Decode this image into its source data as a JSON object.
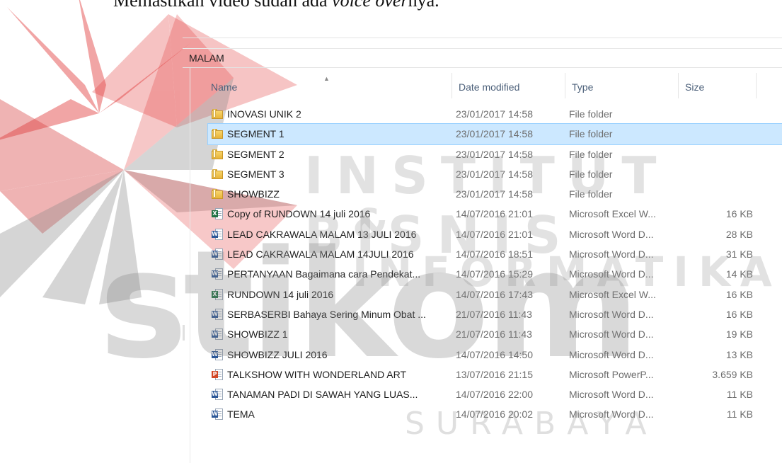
{
  "caption": {
    "prefix": "Memastikan video sudah ada ",
    "italic": "voice over",
    "suffix": "nya."
  },
  "watermark": {
    "line1": "INSTITUT BISNIS",
    "line2": "& INFORMATIKA",
    "brand": "stikom",
    "city": "SURABAYA"
  },
  "explorer": {
    "path": "MALAM",
    "columns": {
      "name": "Name",
      "date": "Date modified",
      "type": "Type",
      "size": "Size"
    },
    "files": [
      {
        "name": "INOVASI UNIK 2",
        "date": "23/01/2017 14:58",
        "type": "File folder",
        "size": "",
        "icon": "folder-icon"
      },
      {
        "name": "SEGMENT 1",
        "date": "23/01/2017 14:58",
        "type": "File folder",
        "size": "",
        "icon": "folder-icon",
        "selected": true
      },
      {
        "name": "SEGMENT 2",
        "date": "23/01/2017 14:58",
        "type": "File folder",
        "size": "",
        "icon": "folder-icon"
      },
      {
        "name": "SEGMENT 3",
        "date": "23/01/2017 14:58",
        "type": "File folder",
        "size": "",
        "icon": "folder-icon"
      },
      {
        "name": "SHOWBIZZ",
        "date": "23/01/2017 14:58",
        "type": "File folder",
        "size": "",
        "icon": "folder-icon"
      },
      {
        "name": "Copy of RUNDOWN 14 juli 2016",
        "date": "14/07/2016 21:01",
        "type": "Microsoft Excel W...",
        "size": "16 KB",
        "icon": "excel-file-icon"
      },
      {
        "name": "LEAD CAKRAWALA MALAM  13 JULI  2016",
        "date": "14/07/2016 21:01",
        "type": "Microsoft Word D...",
        "size": "28 KB",
        "icon": "word-file-icon"
      },
      {
        "name": "LEAD CAKRAWALA MALAM  14JULI  2016",
        "date": "14/07/2016 18:51",
        "type": "Microsoft Word D...",
        "size": "31 KB",
        "icon": "word-file-icon"
      },
      {
        "name": "PERTANYAAN Bagaimana cara Pendekat...",
        "date": "14/07/2016 15:29",
        "type": "Microsoft Word D...",
        "size": "14 KB",
        "icon": "word-file-icon"
      },
      {
        "name": "RUNDOWN 14 juli 2016",
        "date": "14/07/2016 17:43",
        "type": "Microsoft Excel W...",
        "size": "16 KB",
        "icon": "excel-file-icon"
      },
      {
        "name": "SERBASERBI Bahaya Sering Minum Obat ...",
        "date": "21/07/2016 11:43",
        "type": "Microsoft Word D...",
        "size": "16 KB",
        "icon": "word-file-icon"
      },
      {
        "name": "SHOWBIZZ 1",
        "date": "21/07/2016 11:43",
        "type": "Microsoft Word D...",
        "size": "19 KB",
        "icon": "word-file-icon"
      },
      {
        "name": "SHOWBIZZ JULI 2016",
        "date": "14/07/2016 14:50",
        "type": "Microsoft Word D...",
        "size": "13 KB",
        "icon": "word-file-icon"
      },
      {
        "name": "TALKSHOW WITH WONDERLAND ART",
        "date": "13/07/2016 21:15",
        "type": "Microsoft PowerP...",
        "size": "3.659 KB",
        "icon": "powerpoint-file-icon"
      },
      {
        "name": "TANAMAN PADI DI SAWAH YANG LUAS...",
        "date": "14/07/2016 22:00",
        "type": "Microsoft Word D...",
        "size": "11 KB",
        "icon": "word-file-icon"
      },
      {
        "name": "TEMA",
        "date": "14/07/2016 20:02",
        "type": "Microsoft Word D...",
        "size": "11 KB",
        "icon": "word-file-icon"
      }
    ]
  }
}
